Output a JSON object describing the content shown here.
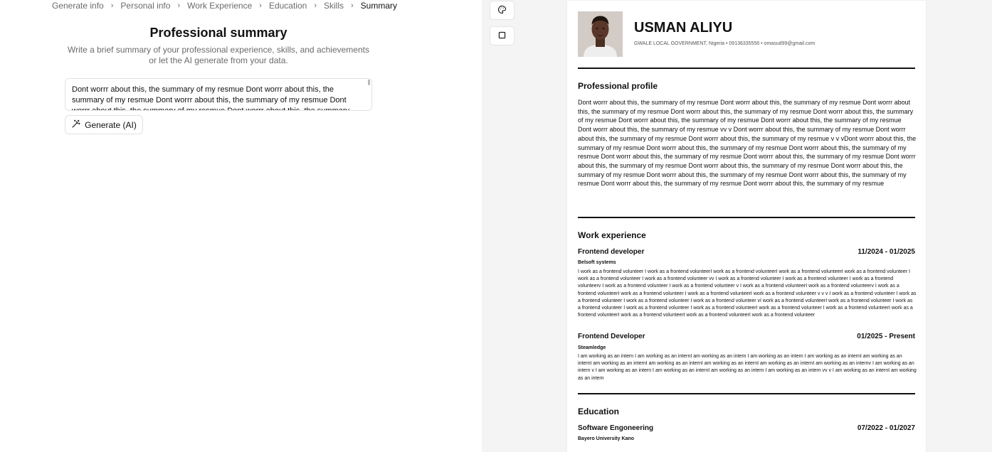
{
  "breadcrumb": {
    "items": [
      {
        "label": "Generate info"
      },
      {
        "label": "Personal info"
      },
      {
        "label": "Work Experience"
      },
      {
        "label": "Education"
      },
      {
        "label": "Skills"
      },
      {
        "label": "Summary"
      }
    ]
  },
  "editor": {
    "title": "Professional summary",
    "description": "Write a brief summary of your professional experience, skills, and achievements or let the AI generate from your data.",
    "summary_value": "Dont worrr about this, the summary of my resmue  Dont worrr about this, the summary of my resmue Dont worrr about this, the summary of my resmue  Dont worrr about this, the summary of my resmue  Dont worrr about this, the summary",
    "generate_label": "Generate (AI)"
  },
  "preview_tools": {
    "palette_icon": "palette-icon",
    "border_icon": "square-icon"
  },
  "resume": {
    "name": "USMAN ALIYU",
    "contact": "GWALE LOCAL GOVERNMENT, Nigeria • 09136335556 • omasud99@gmail.com",
    "profile": {
      "title": "Professional profile",
      "text": "Dont worrr about this, the summary of my resmue Dont worrr about this, the summary of my resmue Dont worrr about this, the summary of my resmue Dont worrr about this, the summary of my resmue Dont worrr about this, the summary of my resmue Dont worrr about this, the summary of my resmue Dont worrr about this, the summary of my resmue Dont worrr about this, the summary of my resmue vv v Dont worrr about this, the summary of my resmue Dont worrr about this, the summary of my resmue Dont worrr about this, the summary of my resmue v v vDont worrr about this, the summary of my resmue Dont worrr about this, the summary of my resmue Dont worrr about this, the summary of my resmue Dont worrr about this, the summary of my resmue Dont worrr about this, the summary of my resmue Dont worrr about this, the summary of my resmue Dont worrr about this, the summary of my resmue Dont worrr about this, the summary of my resmue Dont worrr about this, the summary of my resmue Dont worrr about this, the summary of my resmue Dont worrr about this, the summary of my resmue Dont worrr about this, the summary of my resmue"
    },
    "experience": {
      "title": "Work experience",
      "items": [
        {
          "role": "Frontend developer",
          "dates": "11/2024 - 01/2025",
          "company": "Belsoft systems",
          "description": "I work as a frontend volunteer I work as a frontend volunteerI work as a frontend volunteerI work as a frontend volunteerI work as a frontend volunteer I work as a frontend volunteer I work as a frontend volunteer vv I work as a frontend volunteer I work as a frontend volunteer I work as a frontend volunteerv I work as a frontend volunteer I work as a frontend volunteer v I work as a frontend volunteerI work as a frontend volunteerv I work as a frontend volunteerI work as a frontend volunteer I work as a frontend volunteerI work as a frontend volunteer v v v I work as a frontend volunteer I work as a frontend volunteer I work as a frontend volunteer I work as a frontend volunteer vI work as a frontend volunteerI work as a frontend volunteer I work as a frontend volunteer I work as a frontend volunteer I work as a frontend volunteerI work as a frontend volunteer I work as a frontend volunteerI work as a frontend volunteerI work as a frontend volunteerI work as a frontend volunteerI work as a frontend volunteer"
        },
        {
          "role": "Frontend Developer",
          "dates": "01/2025 - Present",
          "company": "Steamledge",
          "description": "I am working as an intern I am working as an internI am working as an intern I am working as an intern I am working as an internI am working as an internI am working as an internI am working as an internI am working as an internI am working as an internI am working as an internv I am working as an intern v I am working as an intern I am working as an internI am working as an intern I am working as an intern vv v I am working as an internI am working as an intern"
        }
      ]
    },
    "education": {
      "title": "Education",
      "items": [
        {
          "degree": "Software Engoneering",
          "dates": "07/2022 - 01/2027",
          "school": "Bayero University Kano"
        }
      ]
    }
  }
}
